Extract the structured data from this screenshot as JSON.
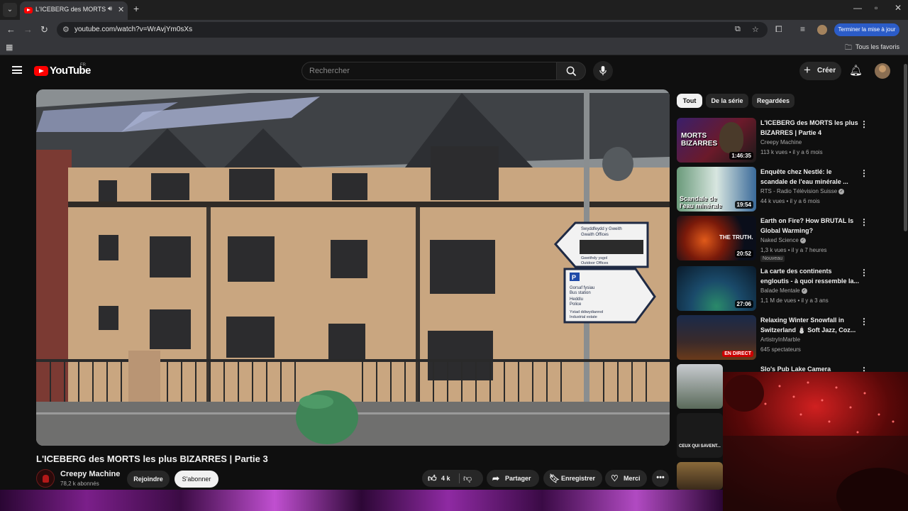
{
  "browser": {
    "tab_title": "L'ICEBERG des MORTS les p",
    "url": "youtube.com/watch?v=WrAvjYm0sXs",
    "update_button": "Terminer la mise à jour",
    "bookmarks_folder": "Tous les favoris"
  },
  "header": {
    "logo_text": "YouTube",
    "country_code": "FR",
    "search_placeholder": "Rechercher",
    "create_label": "Créer"
  },
  "video": {
    "title": "L'ICEBERG des MORTS les plus BIZARRES | Partie 3",
    "channel_name": "Creepy Machine",
    "subscribers": "78,2 k abonnés",
    "join_label": "Rejoindre",
    "subscribe_label": "S'abonner",
    "likes": "4 k",
    "share_label": "Partager",
    "save_label": "Enregistrer",
    "thanks_label": "Merci",
    "scene_signs": {
      "sign1_line1": "Swyddfeydd y Gweith",
      "sign1_line2": "Gwaith Offices",
      "sign1_line3": "Gweithdy ysgol",
      "sign1_line4": "Outdoor Offices",
      "sign2_line1": "Gorsaf fysiau",
      "sign2_line2": "Bus station",
      "sign2_line3": "Heddlu",
      "sign2_line4": "Police",
      "sign2_line5": "Ystad ddiwydiannol",
      "sign2_line6": "Industrial estate"
    }
  },
  "chips": [
    "Tout",
    "De la série",
    "Regardées"
  ],
  "recommendations": [
    {
      "title": "L'ICEBERG des MORTS les plus BIZARRES | Partie 4",
      "channel": "Creepy Machine",
      "verified": false,
      "meta": "113 k vues • il y a 6 mois",
      "duration": "1:46:35",
      "thumb_text": "MORTS BIZARRES"
    },
    {
      "title": "Enquête chez Nestlé: le scandale de l'eau minérale ...",
      "channel": "RTS - Radio Télévision Suisse",
      "verified": true,
      "meta": "44 k vues • il y a 6 mois",
      "duration": "19:54",
      "thumb_text": "Scandale de l'eau minérale"
    },
    {
      "title": "Earth on Fire? How BRUTAL Is Global Warming?",
      "channel": "Naked Science",
      "verified": true,
      "meta": "1,3 k vues • il y a 7 heures",
      "duration": "20:52",
      "badge": "Nouveau",
      "thumb_text": "THE TRUTH."
    },
    {
      "title": "La carte des continents engloutis - à quoi ressemble la...",
      "channel": "Balade Mentale",
      "verified": true,
      "meta": "1,1 M de vues • il y a 3 ans",
      "duration": "27:06"
    },
    {
      "title": "Relaxing Winter Snowfall in Switzerland ⛄ Soft Jazz, Coz...",
      "channel": "ArtistryInMarble",
      "verified": false,
      "meta": "645 spectateurs",
      "live_label": "EN DIRECT"
    },
    {
      "title": "Slo's Pub Lake Camera",
      "channel": "",
      "meta": ""
    },
    {
      "title": "",
      "thumb_text": "CEUX QUI SAVENT..."
    },
    {
      "title": ""
    }
  ],
  "colors": {
    "background": "#0f0f0f",
    "accent_red": "#ff0000",
    "update_blue": "#2b5cc8"
  }
}
